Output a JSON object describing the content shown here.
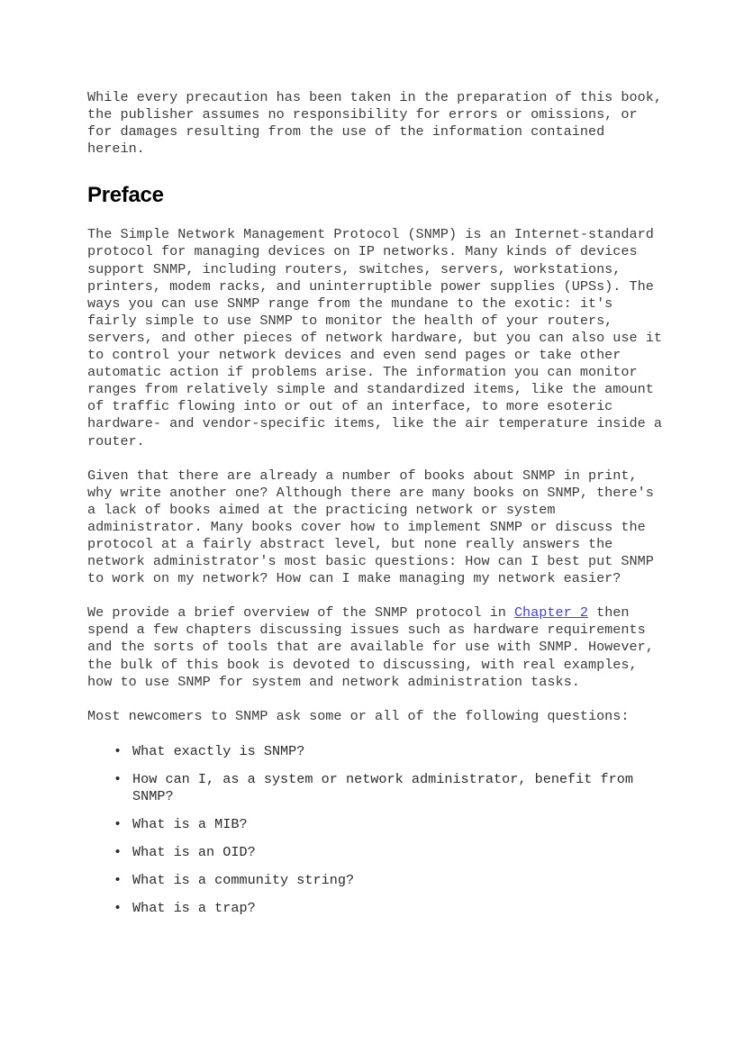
{
  "page": {
    "background_color": "#ffffff",
    "text_color": "#3c3c3c",
    "heading_color": "#000000",
    "link_color": "#4343cf"
  },
  "notice": {
    "text": "While every precaution has been taken in the preparation of this book, the publisher assumes no responsibility for errors or omissions, or for damages resulting from the use of the information contained herein."
  },
  "heading": {
    "title": "Preface"
  },
  "paragraphs": [
    {
      "text": "The Simple Network Management Protocol (SNMP) is an Internet-standard protocol for managing devices on IP networks. Many kinds of devices support SNMP, including routers, switches, servers, workstations, printers, modem racks, and uninterruptible power supplies (UPSs). The ways you can use SNMP range from the mundane to the exotic: it's fairly simple to use SNMP to monitor the health of your routers, servers, and other pieces of network hardware, but you can also use it to control your network devices and even send pages or take other automatic action if problems arise. The information you can monitor ranges from relatively simple and standardized items, like the amount of traffic flowing into or out of an interface, to more esoteric hardware- and vendor-specific items, like the air temperature inside a router."
    },
    {
      "text": "Given that there are already a number of books about SNMP in print, why write another one? Although there are many books on SNMP, there's a lack of books aimed at the practicing network or system administrator. Many books cover how to implement SNMP or discuss the protocol at a fairly abstract level, but none really answers the network administrator's most basic questions: How can I best put SNMP to work on my network? How can I make managing my network easier?"
    }
  ],
  "linked_paragraph": {
    "before": "We provide a brief overview of the SNMP protocol in ",
    "link_text": "Chapter 2",
    "after": " then spend a few chapters discussing issues such as hardware requirements and the sorts of tools that are available for use with SNMP. However, the bulk of this book is devoted to discussing, with real examples, how to use SNMP for system and network administration tasks."
  },
  "list_intro": {
    "text": "Most newcomers to SNMP ask some or all of the following questions:"
  },
  "questions": {
    "bullet_glyph": "•",
    "items": [
      {
        "text": "What exactly is SNMP?"
      },
      {
        "text": "How can I, as a system or network administrator, benefit from SNMP?"
      },
      {
        "text": "What is a MIB?"
      },
      {
        "text": "What is an OID?"
      },
      {
        "text": "What is a community string?"
      },
      {
        "text": "What is a trap?"
      }
    ]
  }
}
